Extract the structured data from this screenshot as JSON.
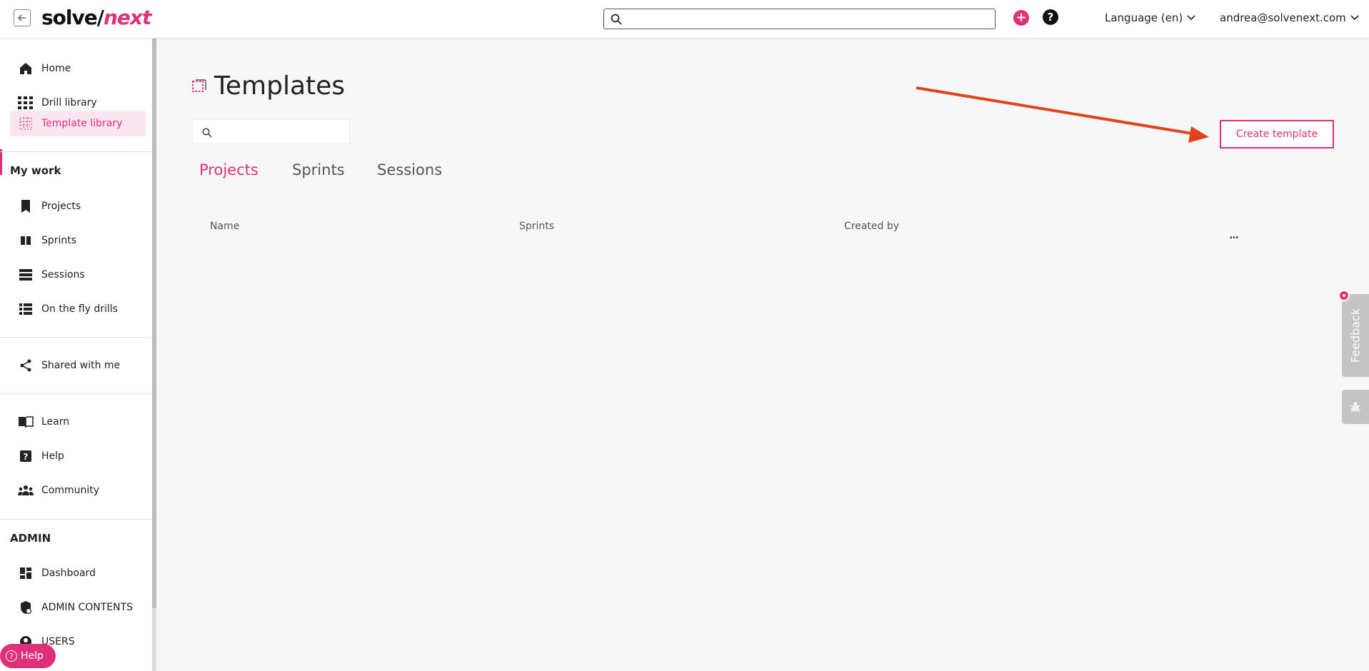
{
  "header": {
    "logo_part1": "solve/",
    "logo_part2": "next",
    "search_placeholder": "",
    "language": "Language (en)",
    "user_email": "andrea@solvenext.com"
  },
  "sidebar": {
    "top_items": [
      {
        "label": "Home",
        "icon": "home-icon"
      },
      {
        "label": "Drill library",
        "icon": "grid-icon"
      },
      {
        "label": "Template library",
        "icon": "dotted-grid-icon"
      }
    ],
    "my_work_title": "My work",
    "my_work_items": [
      {
        "label": "Projects",
        "icon": "bookmark-icon"
      },
      {
        "label": "Sprints",
        "icon": "columns-icon"
      },
      {
        "label": "Sessions",
        "icon": "stack-icon"
      },
      {
        "label": "On the fly drills",
        "icon": "list-icon"
      }
    ],
    "shared_item": {
      "label": "Shared with me",
      "icon": "share-icon"
    },
    "resources_items": [
      {
        "label": "Learn",
        "icon": "book-icon"
      },
      {
        "label": "Help",
        "icon": "question-icon"
      },
      {
        "label": "Community",
        "icon": "people-icon"
      }
    ],
    "admin_title": "ADMIN",
    "admin_items": [
      {
        "label": "Dashboard",
        "icon": "dashboard-icon"
      },
      {
        "label": "ADMIN CONTENTS",
        "icon": "shield-icon"
      },
      {
        "label": "USERS",
        "icon": "user-icon"
      }
    ],
    "help_pill": "Help"
  },
  "main": {
    "title": "Templates",
    "search_placeholder": "",
    "create_button": "Create template",
    "tabs": [
      "Projects",
      "Sprints",
      "Sessions"
    ],
    "active_tab": "Projects",
    "columns": [
      "Name",
      "Sprints",
      "Created by"
    ],
    "more": "..."
  },
  "widgets": {
    "feedback_label": "Feedback"
  },
  "colors": {
    "accent": "#e0307a",
    "annotation_arrow": "#e0431f"
  }
}
